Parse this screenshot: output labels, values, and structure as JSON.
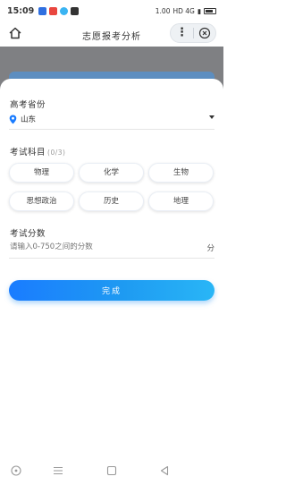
{
  "status_bar": {
    "time": "15:09",
    "network_speed": "1.00",
    "signal_text": "HD 4G",
    "battery_text": ""
  },
  "header": {
    "title": "志愿报考分析"
  },
  "form": {
    "province_label": "高考省份",
    "province_value": "山东",
    "subjects_label": "考试科目",
    "subjects_count": "(0/3)",
    "subjects": [
      "物理",
      "化学",
      "生物",
      "思想政治",
      "历史",
      "地理"
    ],
    "score_label": "考试分数",
    "score_placeholder": "请输入0-750之间的分数",
    "score_unit": "分",
    "submit_label": "完成"
  },
  "colors": {
    "accent": "#1a7cff",
    "accent_end": "#29b6f6",
    "backdrop": "#7f8083"
  }
}
